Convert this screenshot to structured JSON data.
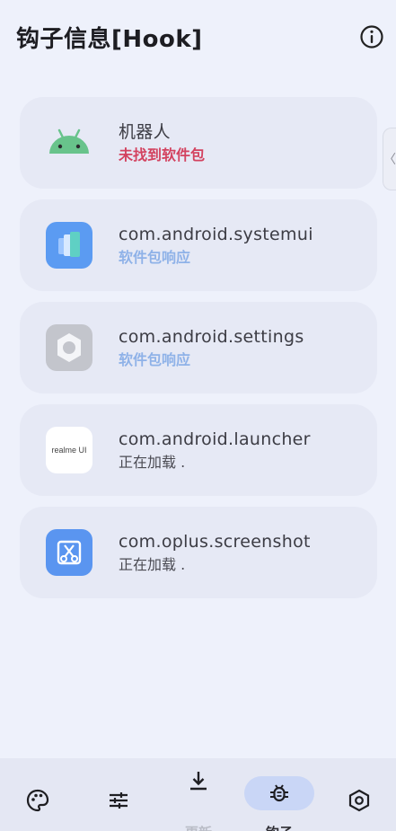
{
  "header": {
    "title": "钩子信息[Hook]",
    "info_icon": "info-icon"
  },
  "apps": [
    {
      "name": "机器人",
      "status": "未找到软件包",
      "status_color": "#d3425f",
      "icon": "android-robot-icon"
    },
    {
      "name": "com.android.systemui",
      "status": "软件包响应",
      "status_color": "#8fb2e8",
      "icon": "systemui-icon"
    },
    {
      "name": "com.android.settings",
      "status": "软件包响应",
      "status_color": "#8fb2e8",
      "icon": "settings-icon"
    },
    {
      "name": "com.android.launcher",
      "status": "正在加载 .",
      "status_color": "#4a4a52",
      "icon": "realme-ui-icon",
      "icon_text": "realme UI"
    },
    {
      "name": "com.oplus.screenshot",
      "status": "正在加载 .",
      "status_color": "#4a4a52",
      "icon": "screenshot-icon"
    }
  ],
  "side_handle": {
    "glyph": "〈"
  },
  "bottom_nav": {
    "items": [
      {
        "icon": "palette-icon"
      },
      {
        "icon": "sliders-icon"
      },
      {
        "icon": "download-icon",
        "label": "更新"
      },
      {
        "icon": "bug-icon",
        "label": "钩子",
        "active": true
      },
      {
        "icon": "hexagon-settings-icon"
      }
    ],
    "active_color": "#c9d6f6"
  }
}
